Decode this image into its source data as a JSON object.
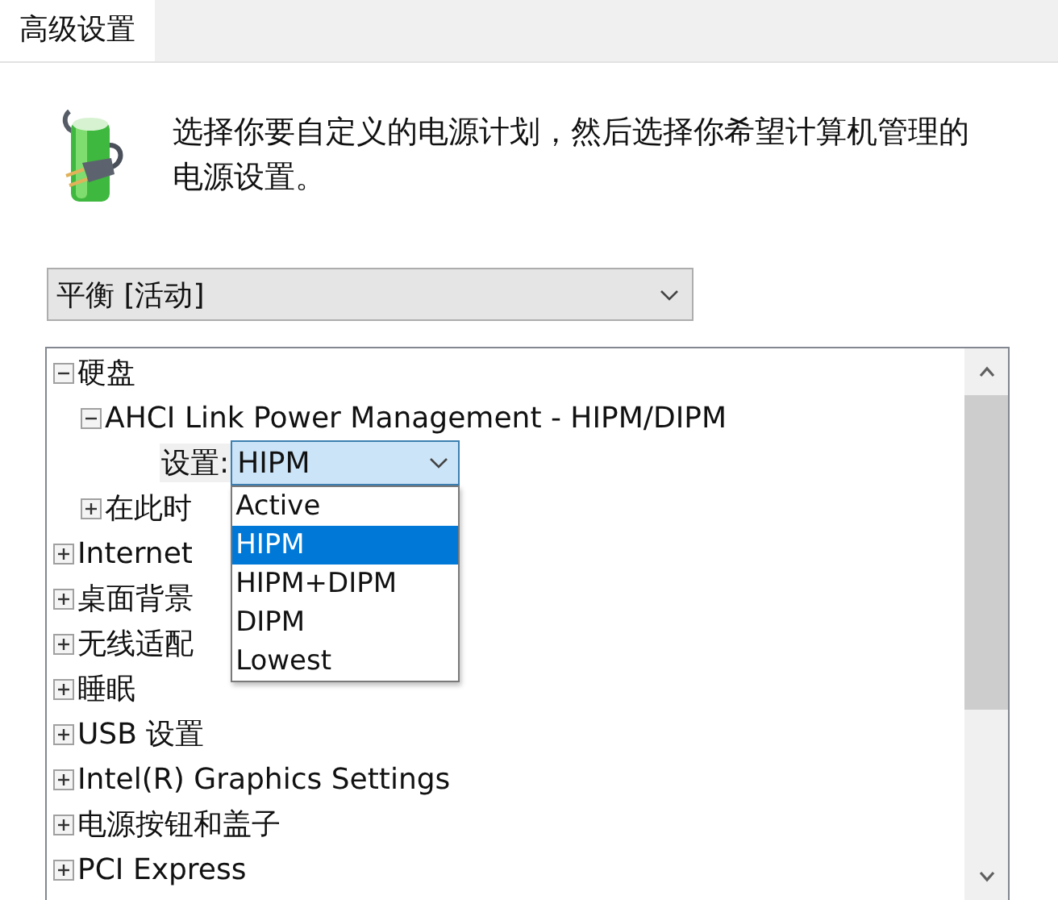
{
  "tabs": [
    {
      "label": "高级设置",
      "selected": true
    }
  ],
  "description": "选择你要自定义的电源计划，然后选择你希望计算机管理的电源设置。",
  "plan_select": {
    "value": "平衡 [活动]"
  },
  "tree": [
    {
      "label": "硬盘",
      "expanded": true,
      "children": [
        {
          "label": "AHCI Link Power Management - HIPM/DIPM",
          "expanded": true,
          "children": [
            {
              "kind": "setting",
              "label": "设置:",
              "value": "HIPM",
              "expanded": true,
              "options": [
                {
                  "label": "Active",
                  "selected": false
                },
                {
                  "label": "HIPM",
                  "selected": true
                },
                {
                  "label": "HIPM+DIPM",
                  "selected": false
                },
                {
                  "label": "DIPM",
                  "selected": false
                },
                {
                  "label": "Lowest",
                  "selected": false
                }
              ]
            }
          ]
        },
        {
          "label": "在此时",
          "expanded": false
        }
      ]
    },
    {
      "label": "Internet",
      "expanded": false
    },
    {
      "label": "桌面背景",
      "expanded": false
    },
    {
      "label": "无线适配",
      "expanded": false
    },
    {
      "label": "睡眠",
      "expanded": false
    },
    {
      "label": "USB 设置",
      "expanded": false
    },
    {
      "label": "Intel(R) Graphics Settings",
      "expanded": false
    },
    {
      "label": "电源按钮和盖子",
      "expanded": false
    },
    {
      "label": "PCI Express",
      "expanded": false
    }
  ]
}
